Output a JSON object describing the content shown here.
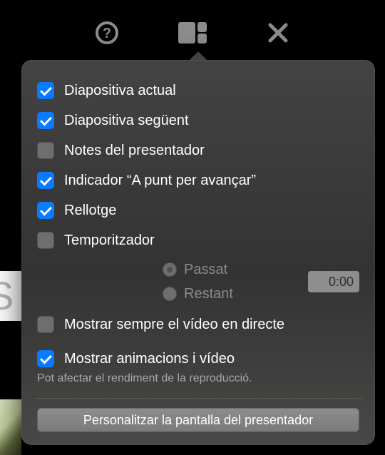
{
  "toolbar": {
    "help_icon": "help-icon",
    "layout_icon": "layout-icon",
    "close_icon": "close-icon"
  },
  "options": {
    "current_slide": {
      "label": "Diapositiva actual",
      "checked": true
    },
    "next_slide": {
      "label": "Diapositiva següent",
      "checked": true
    },
    "presenter_notes": {
      "label": "Notes del presentador",
      "checked": false
    },
    "ready_indicator": {
      "label": "Indicador “A punt per avançar”",
      "checked": true
    },
    "clock": {
      "label": "Rellotge",
      "checked": true
    },
    "timer": {
      "label": "Temporitzador",
      "checked": false,
      "modes": {
        "elapsed": "Passat",
        "remaining": "Restant"
      },
      "value": "0:00"
    },
    "live_video": {
      "label": "Mostrar sempre el vídeo en directe",
      "checked": false
    },
    "animations": {
      "label": "Mostrar animacions i vídeo",
      "checked": true,
      "note": "Pot afectar el rendiment de la reproducció."
    }
  },
  "customize_button": "Personalitzar la pantalla del presentador"
}
